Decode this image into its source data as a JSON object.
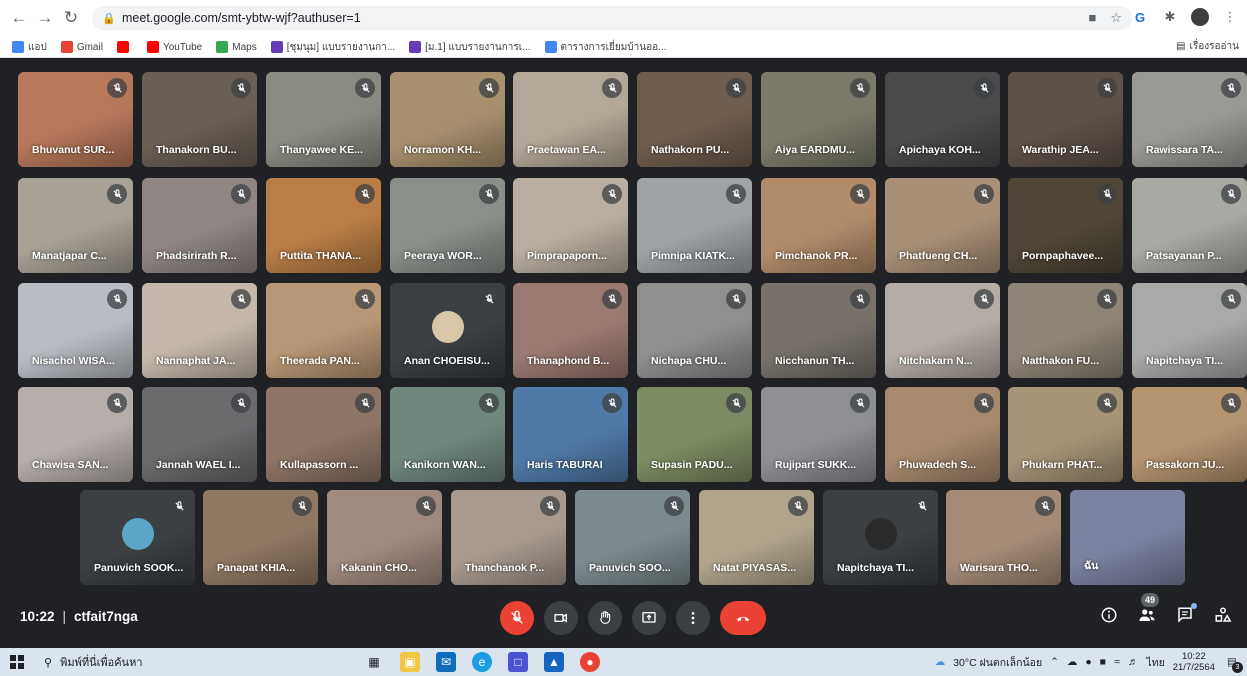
{
  "browser": {
    "url": "meet.google.com/smt-ybtw-wjf?authuser=1",
    "bookmarks": [
      {
        "label": "แอป",
        "color": "#4285f4"
      },
      {
        "label": "Gmail",
        "color": "#ea4335"
      },
      {
        "label": "",
        "color": "#ff0000"
      },
      {
        "label": "YouTube",
        "color": "#ff0000"
      },
      {
        "label": "Maps",
        "color": "#34a853"
      },
      {
        "label": "[ชุมนุม] แบบรายงานกา...",
        "color": "#673ab7"
      },
      {
        "label": "[ม.1] แบบรายงานการเ...",
        "color": "#673ab7"
      },
      {
        "label": "ตารางการเยี่ยมบ้านออ...",
        "color": "#4285f4"
      }
    ],
    "reading_list": "เรื่องรออ่าน"
  },
  "participants": [
    {
      "name": "Bhuvanut SUR...",
      "bg": "#b7775a"
    },
    {
      "name": "Thanakorn BU...",
      "bg": "#6a5f55"
    },
    {
      "name": "Thanyawee KE...",
      "bg": "#8a8a82"
    },
    {
      "name": "Norramon KH...",
      "bg": "#a7906e"
    },
    {
      "name": "Praetawan EA...",
      "bg": "#b3a797"
    },
    {
      "name": "Nathakorn PU...",
      "bg": "#6f5d4f"
    },
    {
      "name": "Aiya EARDMU...",
      "bg": "#7b7a6a"
    },
    {
      "name": "Apichaya KOH...",
      "bg": "#4a4a4a"
    },
    {
      "name": "Warathip JEA...",
      "bg": "#5e5148"
    },
    {
      "name": "Rawissara TA...",
      "bg": "#9b9995"
    },
    {
      "name": "Manatjapar C...",
      "bg": "#a8a196"
    },
    {
      "name": "Phadsirirath R...",
      "bg": "#8f8684"
    },
    {
      "name": "Puttita THANA...",
      "bg": "#b97d45"
    },
    {
      "name": "Peeraya WOR...",
      "bg": "#8a8f8a"
    },
    {
      "name": "Pimprapaporn...",
      "bg": "#b8ada0"
    },
    {
      "name": "Pimnipa KIATK...",
      "bg": "#9fa3a5"
    },
    {
      "name": "Pimchanok PR...",
      "bg": "#b28c6a"
    },
    {
      "name": "Phatfueng CH...",
      "bg": "#a89078"
    },
    {
      "name": "Pornpaphavee...",
      "bg": "#4f4637"
    },
    {
      "name": "Patsayanan P...",
      "bg": "#a9a9a3"
    },
    {
      "name": "Nisachol WISA...",
      "bg": "#b9bcc3"
    },
    {
      "name": "Nannaphat JA...",
      "bg": "#c5b8ab"
    },
    {
      "name": "Theerada PAN...",
      "bg": "#b79776"
    },
    {
      "name": "Anan CHOEISU...",
      "bg": "#3c4043",
      "avatar": "#d8c8a8"
    },
    {
      "name": "Thanaphond B...",
      "bg": "#9b7a72"
    },
    {
      "name": "Nichapa CHU...",
      "bg": "#8f8f8d"
    },
    {
      "name": "Nicchanun TH...",
      "bg": "#77716a"
    },
    {
      "name": "Nitchakarn N...",
      "bg": "#b5aca5"
    },
    {
      "name": "Natthakon FU...",
      "bg": "#8f8577"
    },
    {
      "name": "Napitchaya TI...",
      "bg": "#a9aaa8"
    },
    {
      "name": "Chawisa SAN...",
      "bg": "#b6aeaa"
    },
    {
      "name": "Jannah WAEL I...",
      "bg": "#6b6a6d"
    },
    {
      "name": "Kullapassorn ...",
      "bg": "#8d7567"
    },
    {
      "name": "Kanikorn WAN...",
      "bg": "#70877e"
    },
    {
      "name": "Haris TABURAI",
      "bg": "#4f7aa8"
    },
    {
      "name": "Supasin PADU...",
      "bg": "#7c8b63"
    },
    {
      "name": "Rujipart SUKK...",
      "bg": "#8e8f94"
    },
    {
      "name": "Phuwadech S...",
      "bg": "#a68a6f"
    },
    {
      "name": "Phukarn PHAT...",
      "bg": "#a69478"
    },
    {
      "name": "Passakorn JU...",
      "bg": "#b49570"
    },
    {
      "name": "Panuvich SOOK...",
      "bg": "#3c4043",
      "avatar": "#5ba6c9"
    },
    {
      "name": "Panapat KHIA...",
      "bg": "#8f7864"
    },
    {
      "name": "Kakanin CHO...",
      "bg": "#9f8a80"
    },
    {
      "name": "Thanchanok P...",
      "bg": "#a89a8f"
    },
    {
      "name": "Panuvich SOO...",
      "bg": "#7c8a8e"
    },
    {
      "name": "Natat PIYASAS...",
      "bg": "#b0a48d"
    },
    {
      "name": "Napitchaya TI...",
      "bg": "#3c4043",
      "avatar": "#2b2b2b"
    },
    {
      "name": "Warisara THO...",
      "bg": "#a48c78"
    },
    {
      "name": "ฉัน",
      "bg": "#7b82a0"
    }
  ],
  "meeting": {
    "time": "10:22",
    "code": "ctfait7nga",
    "people_count": "49"
  },
  "taskbar": {
    "search_placeholder": "พิมพ์ที่นี่เพื่อค้นหา",
    "weather": "30°C ฝนตกเล็กน้อย",
    "lang": "ไทย",
    "time": "10:22",
    "date": "21/7/2564",
    "notif_count": "3"
  },
  "colors": {
    "meet_bg": "#202124",
    "tile_bg": "#3c4043",
    "danger": "#ea4335"
  }
}
